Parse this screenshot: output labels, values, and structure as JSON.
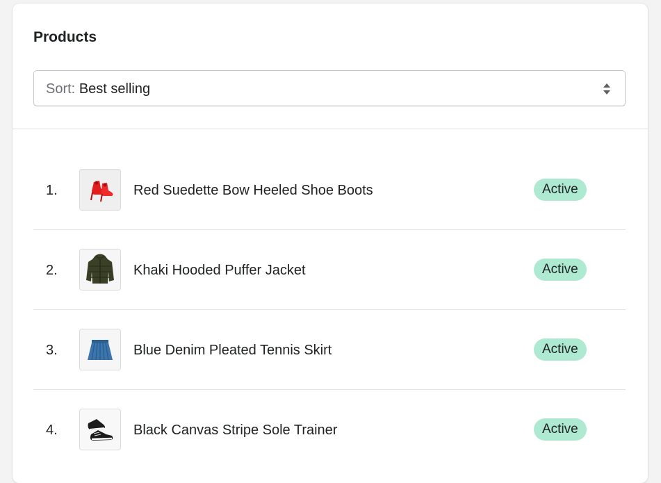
{
  "card": {
    "title": "Products"
  },
  "sort": {
    "prefix": "Sort:",
    "value": "Best selling",
    "icon": "select-arrows-icon"
  },
  "products": [
    {
      "rank": "1.",
      "name": "Red Suedette Bow Heeled Shoe Boots",
      "status": "Active",
      "thumbnail": "red-heeled-boots-image"
    },
    {
      "rank": "2.",
      "name": "Khaki Hooded Puffer Jacket",
      "status": "Active",
      "thumbnail": "khaki-puffer-jacket-image"
    },
    {
      "rank": "3.",
      "name": "Blue Denim Pleated Tennis Skirt",
      "status": "Active",
      "thumbnail": "denim-skirt-image"
    },
    {
      "rank": "4.",
      "name": "Black Canvas Stripe Sole Trainer",
      "status": "Active",
      "thumbnail": "black-trainers-image"
    }
  ],
  "colors": {
    "status_active_bg": "#aee9d1",
    "background": "#f3f3f3",
    "card": "#ffffff"
  }
}
